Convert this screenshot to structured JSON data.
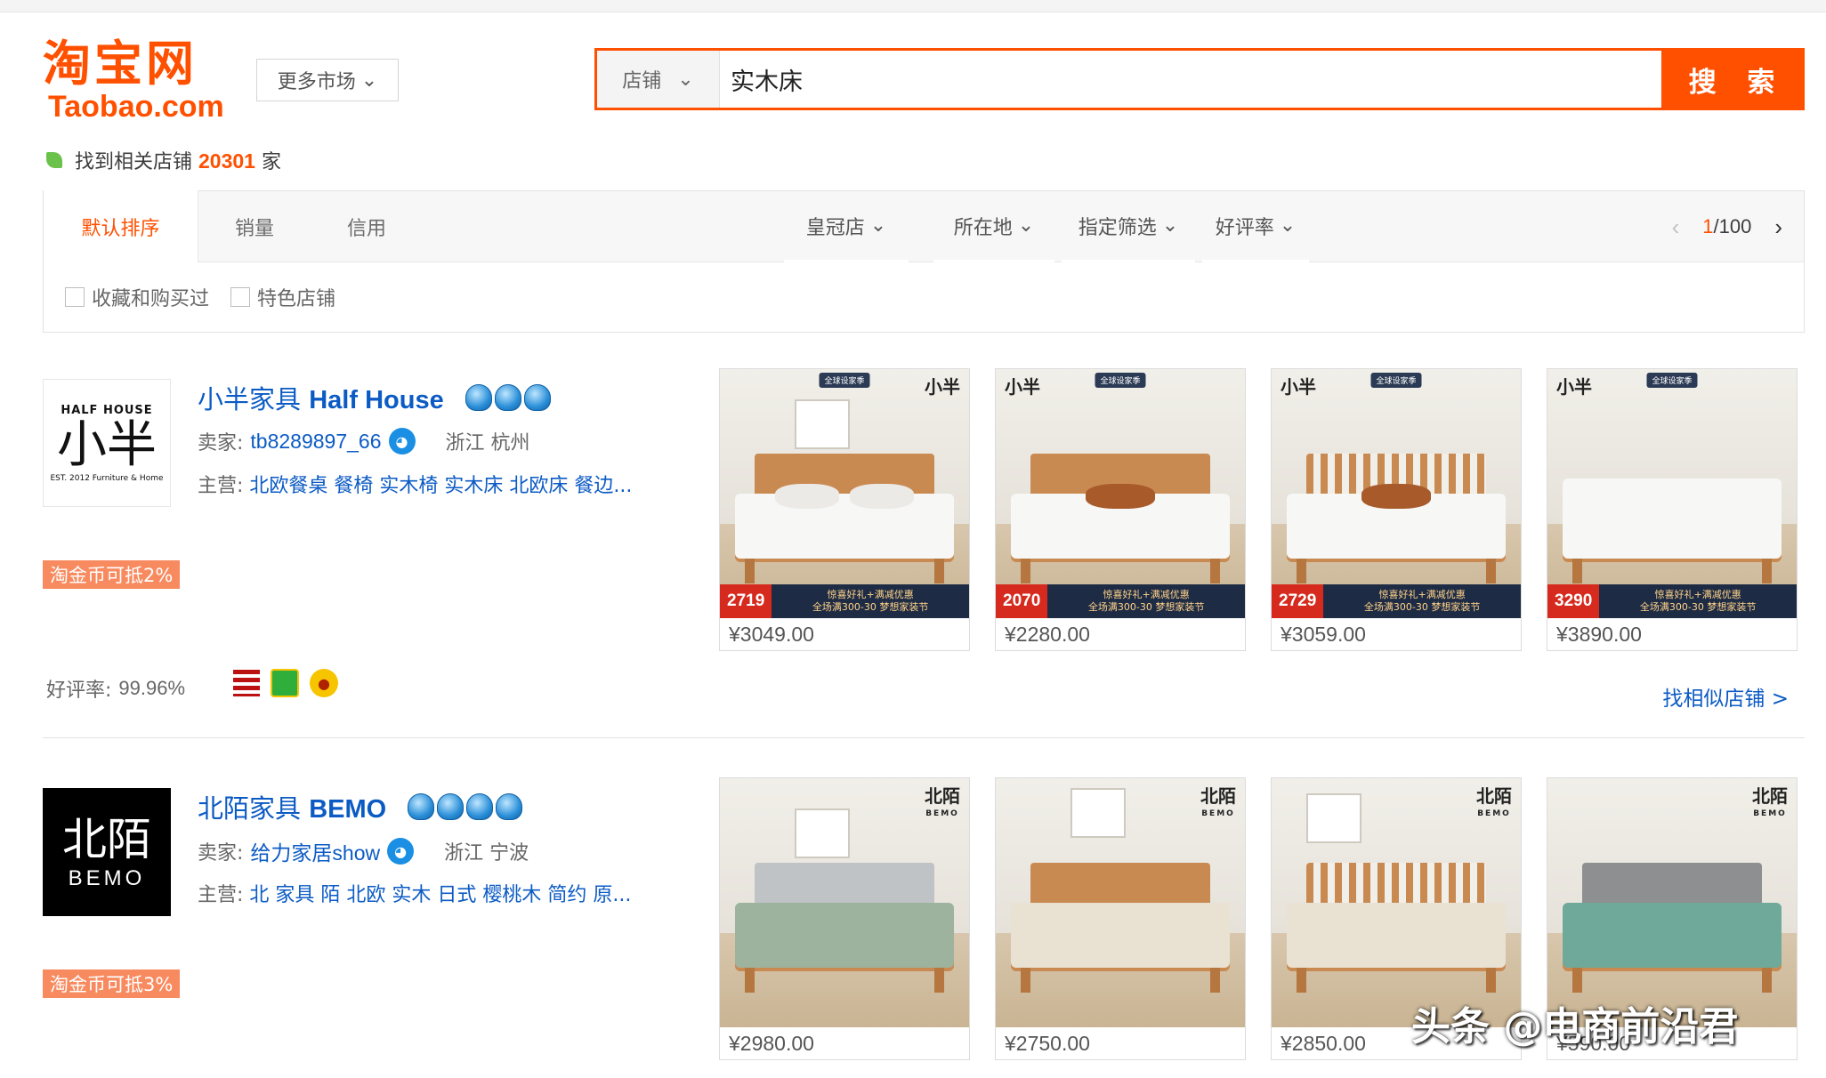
{
  "header": {
    "logo_cn": "淘宝网",
    "logo_en": "Taobao.com",
    "market_label": "更多市场",
    "search_type": "店铺",
    "search_value": "实木床",
    "search_button": "搜 索"
  },
  "results": {
    "prefix": "找到相关店铺",
    "count": "20301",
    "suffix": "家"
  },
  "sort": {
    "tabs": [
      "默认排序",
      "销量",
      "信用"
    ],
    "dropdowns": [
      "皇冠店",
      "所在地",
      "指定筛选",
      "好评率"
    ],
    "page_current": "1",
    "page_total": "/100"
  },
  "checks": [
    "收藏和购买过",
    "特色店铺"
  ],
  "shops": [
    {
      "name_cn": "小半家具",
      "name_en": "Half House",
      "logo_top": "HALF HOUSE",
      "logo_mid": "小半",
      "logo_bottom": "EST. 2012 Furniture & Home",
      "seller_label": "卖家:",
      "seller": "tb8289897_66",
      "location": "浙江 杭州",
      "main_label": "主营:",
      "main": "北欧餐桌 餐椅 实木椅 实木床 北欧床 餐边...",
      "coin": "淘金币可抵2%",
      "rate_label": "好评率:",
      "rate": "99.96%",
      "similar": "找相似店铺 >",
      "products": [
        {
          "badge_price": "2719",
          "price": "¥3049.00"
        },
        {
          "badge_price": "2070",
          "price": "¥2280.00"
        },
        {
          "badge_price": "2729",
          "price": "¥3059.00"
        },
        {
          "badge_price": "3290",
          "price": "¥3890.00"
        }
      ]
    },
    {
      "name_cn": "北陌家具",
      "name_en": "BEMO",
      "logo_top": "北陌",
      "logo_bottom": "BEMO",
      "seller_label": "卖家:",
      "seller": "给力家居show",
      "location": "浙江 宁波",
      "main_label": "主营:",
      "main": "北 家具 陌 北欧 实木 日式 樱桃木 简约 原...",
      "coin": "淘金币可抵3%",
      "products": [
        {
          "price": "¥2980.00"
        },
        {
          "price": "¥2750.00"
        },
        {
          "price": "¥2850.00"
        },
        {
          "price": "¥590.00"
        }
      ]
    }
  ],
  "promo": {
    "tag": "全球设家季",
    "line1": "惊喜好礼+满减优惠",
    "line2": "全场满300-30",
    "fest": "梦想家装节",
    "brand_xb": "小半",
    "brand_bm": "北陌",
    "brand_bm_en": "BEMO"
  },
  "watermark": "头条 @电商前沿君",
  "colors": {
    "accent": "#ff5000",
    "link": "#0c5bc4"
  }
}
